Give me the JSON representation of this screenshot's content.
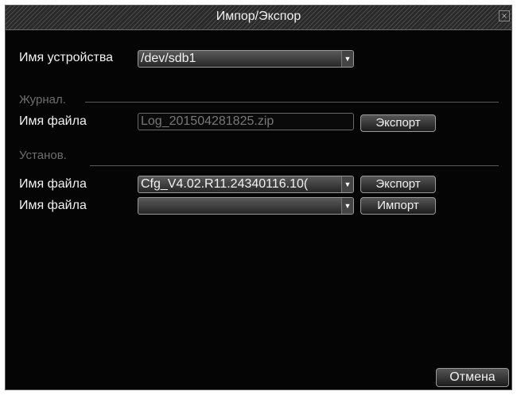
{
  "dialog": {
    "title": "Импор/Экспор",
    "close_glyph": "×"
  },
  "device": {
    "label": "Имя устройства",
    "value": "/dev/sdb1"
  },
  "journal": {
    "section_label": "Журнал.",
    "file_label": "Имя файла",
    "file_value": "Log_201504281825.zip",
    "export_label": "Экспорт"
  },
  "settings": {
    "section_label": "Установ.",
    "export_file_label": "Имя файла",
    "export_file_value": "Cfg_V4.02.R11.24340116.10(",
    "export_label": "Экспорт",
    "import_file_label": "Имя файла",
    "import_file_value": "",
    "import_label": "Импорт"
  },
  "footer": {
    "cancel_label": "Отмена"
  },
  "icons": {
    "dropdown": "chevron-down-icon",
    "close": "close-icon"
  },
  "colors": {
    "background": "#050505",
    "text": "#f2f2f2",
    "section_text": "#6e6e6e"
  }
}
